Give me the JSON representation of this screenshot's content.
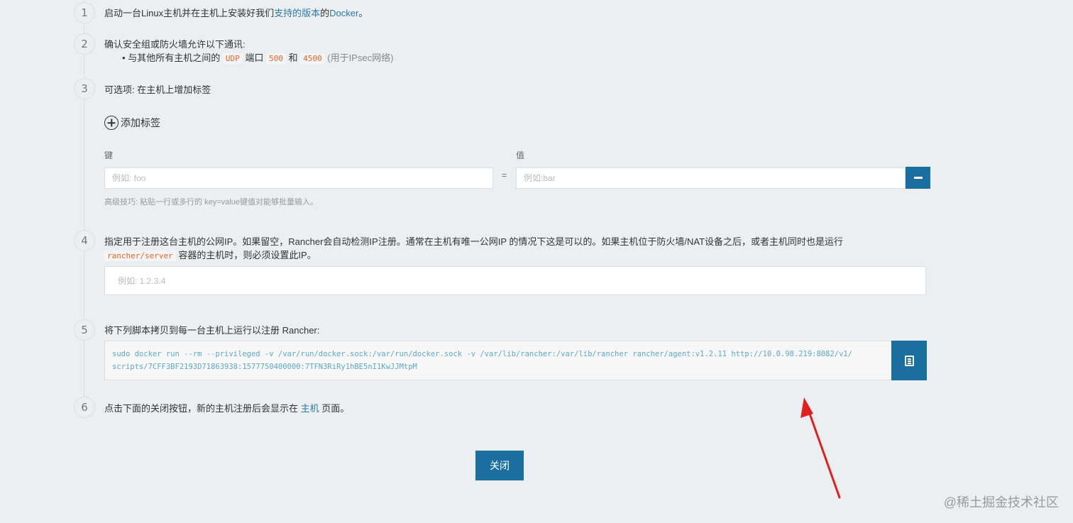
{
  "steps": [
    {
      "num": "1",
      "prefix": "启动一台Linux主机并在主机上安装好我们",
      "link": "支持的版本",
      "mid": "的",
      "link2": "Docker",
      "suffix": "。"
    },
    {
      "num": "2",
      "text": "确认安全组或防火墙允许以下通讯:",
      "bullet": {
        "prefix": "与其他所有主机之间的",
        "code1": "UDP",
        "mid1": "端口",
        "code2": "500",
        "mid2": "和",
        "code3": "4500",
        "suffix": "(用于IPsec网络)"
      }
    },
    {
      "num": "3",
      "text": "可选项: 在主机上增加标签",
      "add_tag_label": "添加标签",
      "key_label": "键",
      "value_label": "值",
      "key_placeholder": "例如: foo",
      "value_placeholder": "例如:bar",
      "equals": "=",
      "hint": "高级技巧: 粘贴一行或多行的 key=value键值对能够批量输入。"
    },
    {
      "num": "4",
      "line1": "指定用于注册这台主机的公网IP。如果留空，Rancher会自动检测IP注册。通常在主机有唯一公网IP 的情况下这是可以的。如果主机位于防火墙/NAT设备之后，或者主机同时也是运行",
      "code": "rancher/server",
      "line2_suffix": "容器的主机时，则必须设置此IP。",
      "ip_placeholder": "例如: 1.2.3.4"
    },
    {
      "num": "5",
      "text": "将下列脚本拷贝到每一台主机上运行以注册 Rancher:",
      "command_line1": "sudo docker run --rm --privileged -v /var/run/docker.sock:/var/run/docker.sock -v /var/lib/rancher:/var/lib/rancher rancher/agent:v1.2.11 http://10.0.98.219:8082/v1/",
      "command_line2": "scripts/7CFF3BF2193D71863938:1577750400000:7TFN3RiRy1hBE5nI1KwJJMtpM"
    },
    {
      "num": "6",
      "prefix": "点击下面的关闭按钮，新的主机注册后会显示在",
      "link": "主机",
      "suffix": "页面。"
    }
  ],
  "close_label": "关闭",
  "watermark": "@稀土掘金技术社区",
  "colors": {
    "accent": "#1a6fa0",
    "link": "#2b78a8",
    "code": "#e8652b",
    "arrow": "#e02020",
    "background": "#eceff1"
  }
}
